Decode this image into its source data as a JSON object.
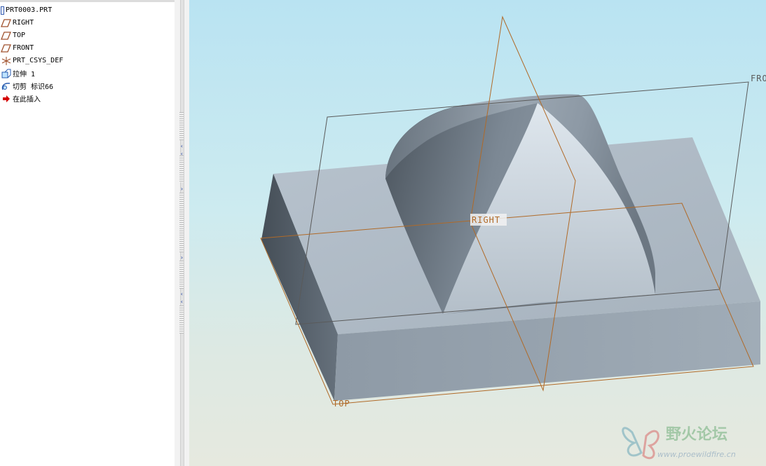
{
  "model_tree": {
    "root": "PRT0003.PRT",
    "items": [
      {
        "label": "RIGHT",
        "icon": "datum-plane-icon"
      },
      {
        "label": "TOP",
        "icon": "datum-plane-icon"
      },
      {
        "label": "FRONT",
        "icon": "datum-plane-icon"
      },
      {
        "label": "PRT_CSYS_DEF",
        "icon": "csys-icon"
      },
      {
        "label": "拉伸 1",
        "icon": "extrude-icon"
      },
      {
        "label": "切剪 标识66",
        "icon": "sweep-cut-icon"
      },
      {
        "label": "在此插入",
        "icon": "insert-here-arrow-icon"
      }
    ]
  },
  "viewport": {
    "datum_labels": {
      "front": "FRONT",
      "right": "RIGHT",
      "top": "TOP"
    },
    "colors": {
      "datum_plane": "#b06a28",
      "front_plane": "#5a5a5a",
      "model_face": "#a9b6c2",
      "model_side": "#4f5964"
    }
  },
  "watermark": {
    "name": "野火论坛",
    "url": "www.proewildfire.cn"
  }
}
